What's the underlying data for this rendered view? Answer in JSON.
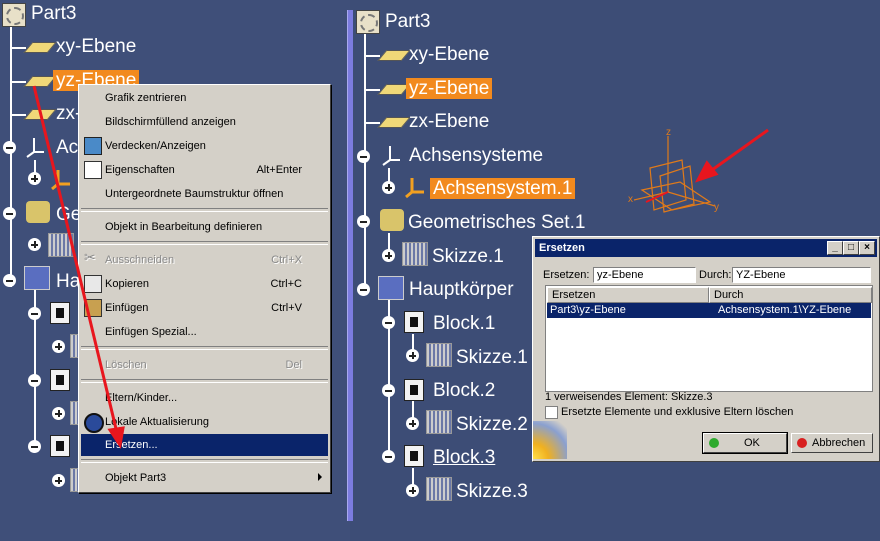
{
  "left_tree": {
    "root": "Part3",
    "items": [
      {
        "key": "xy",
        "label": "xy-Ebene"
      },
      {
        "key": "yz",
        "label": "yz-Ebene"
      },
      {
        "key": "zx",
        "label": "zx-"
      },
      {
        "key": "axsys",
        "label": "Ac"
      },
      {
        "key": "geo",
        "label": "Ge"
      },
      {
        "key": "body",
        "label": "Hau"
      }
    ]
  },
  "context_menu": {
    "items": [
      {
        "label": "Grafik zentrieren",
        "shortcut": ""
      },
      {
        "label": "Bildschirmfüllend anzeigen",
        "shortcut": ""
      },
      {
        "label": "Verdecken/Anzeigen",
        "shortcut": ""
      },
      {
        "label": "Eigenschaften",
        "shortcut": "Alt+Enter"
      },
      {
        "label": "Untergeordnete Baumstruktur öffnen",
        "shortcut": ""
      },
      {
        "label": "Objekt in Bearbeitung definieren",
        "shortcut": ""
      },
      {
        "label": "Ausschneiden",
        "shortcut": "Ctrl+X"
      },
      {
        "label": "Kopieren",
        "shortcut": "Ctrl+C"
      },
      {
        "label": "Einfügen",
        "shortcut": "Ctrl+V"
      },
      {
        "label": "Einfügen Spezial...",
        "shortcut": ""
      },
      {
        "label": "Löschen",
        "shortcut": "Del"
      },
      {
        "label": "Eltern/Kinder...",
        "shortcut": ""
      },
      {
        "label": "Lokale Aktualisierung",
        "shortcut": ""
      },
      {
        "label": "Ersetzen...",
        "shortcut": ""
      },
      {
        "label": "Objekt Part3",
        "shortcut": ""
      }
    ]
  },
  "right_tree": {
    "root": "Part3",
    "xy": "xy-Ebene",
    "yz": "yz-Ebene",
    "zx": "zx-Ebene",
    "axis_systems": "Achsensysteme",
    "axis_system_1": "Achsensystem.1",
    "geoset": "Geometrisches Set.1",
    "sketch1": "Skizze.1",
    "body": "Hauptkörper",
    "block1": "Block.1",
    "block1_sketch": "Skizze.1",
    "block2": "Block.2",
    "block2_sketch": "Skizze.2",
    "block3": "Block.3",
    "block3_sketch": "Skizze.3"
  },
  "axis_labels": {
    "z": "z",
    "x": "x",
    "y": "y"
  },
  "dialog": {
    "title": "Ersetzen",
    "replace_label": "Ersetzen:",
    "replace_value": "yz-Ebene",
    "with_label": "Durch:",
    "with_value": "YZ-Ebene",
    "columns": [
      "Ersetzen",
      "Durch"
    ],
    "rows": [
      [
        "Part3\\yz-Ebene",
        "Achsensystem.1\\YZ-Ebene"
      ]
    ],
    "ref_info": "1 verweisendes Element: Skizze.3",
    "checkbox_label": "Ersetzte Elemente und exklusive Eltern löschen",
    "ok_label": "OK",
    "cancel_label": "Abbrechen",
    "title_buttons": [
      "_",
      "□",
      "×"
    ]
  },
  "colors": {
    "highlight": "#f28a1e",
    "accent": "#0a246a",
    "arrow": "#e8161e"
  }
}
